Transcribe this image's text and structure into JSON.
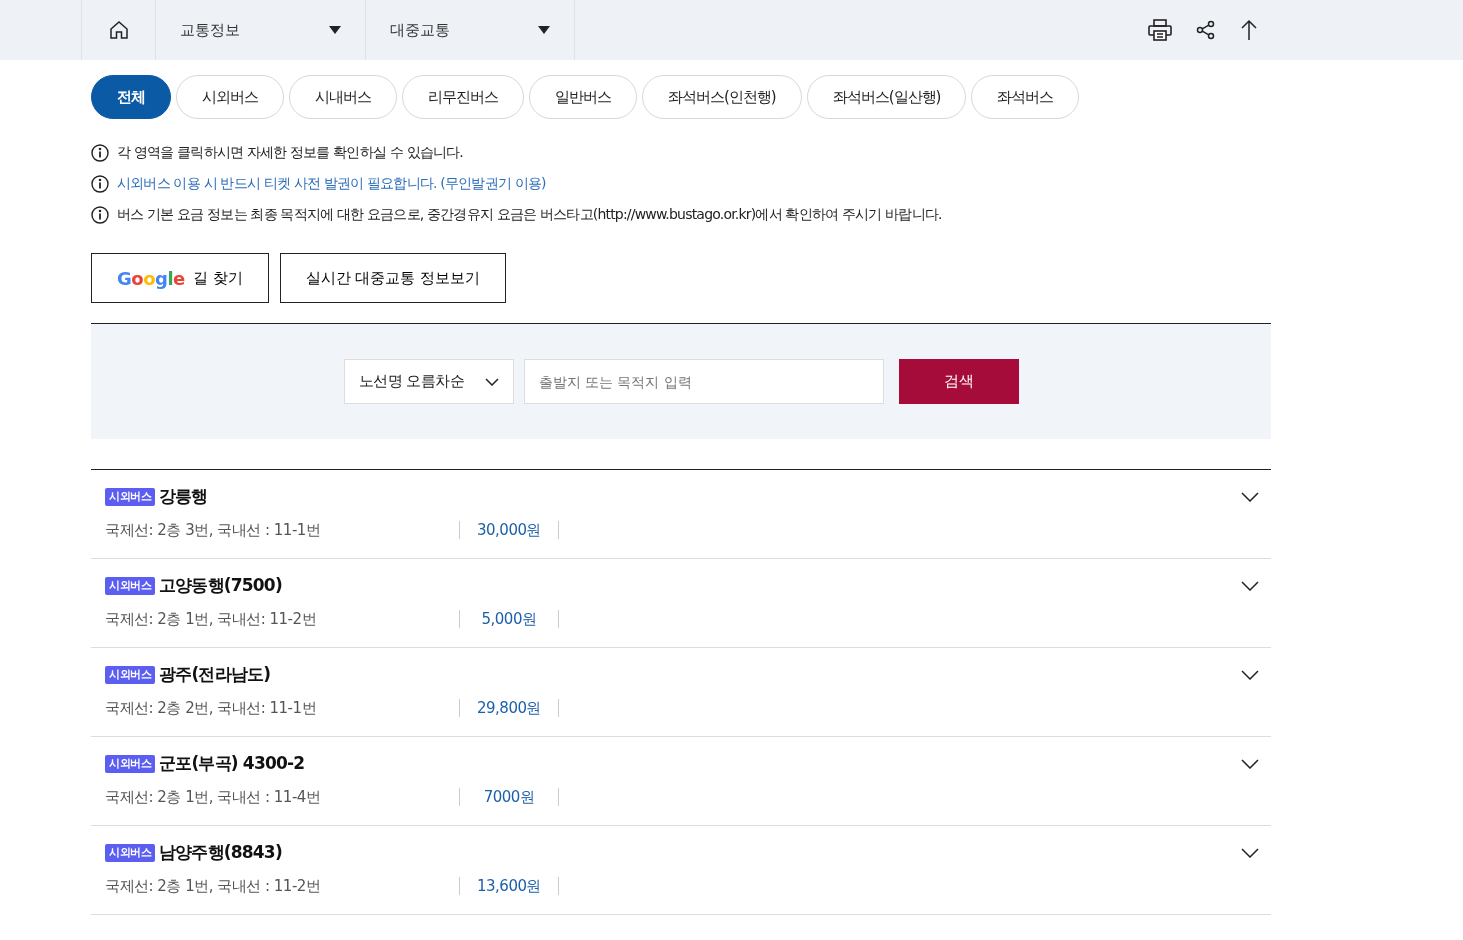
{
  "header": {
    "menus": [
      {
        "label": "교통정보"
      },
      {
        "label": "대중교통"
      }
    ]
  },
  "tabs": [
    {
      "label": "전체",
      "selected": true
    },
    {
      "label": "시외버스",
      "selected": false
    },
    {
      "label": "시내버스",
      "selected": false
    },
    {
      "label": "리무진버스",
      "selected": false
    },
    {
      "label": "일반버스",
      "selected": false
    },
    {
      "label": "좌석버스(인천행)",
      "selected": false
    },
    {
      "label": "좌석버스(일산행)",
      "selected": false
    },
    {
      "label": "좌석버스",
      "selected": false
    }
  ],
  "notices": [
    {
      "text": "각 영역을 클릭하시면 자세한 정보를 확인하실 수 있습니다.",
      "highlighted": false
    },
    {
      "text": "시외버스 이용 시 반드시 티켓 사전 발권이 필요합니다. (무인발권기 이용)",
      "highlighted": true
    },
    {
      "text": "버스 기본 요금 정보는 최종 목적지에 대한 요금으로, 중간경유지 요금은 버스타고(http://www.bustago.or.kr)에서 확인하여 주시기 바랍니다.",
      "highlighted": false
    }
  ],
  "buttons": {
    "google_logo": "Google",
    "google_label": "길 찾기",
    "realtime": "실시간 대중교통 정보보기"
  },
  "search": {
    "sort": "노선명 오름차순",
    "placeholder": "출발지 또는 목적지 입력",
    "button": "검색"
  },
  "routes": [
    {
      "badge": "시외버스",
      "title": "강릉행",
      "location": "국제선: 2층 3번, 국내선 : 11-1번",
      "fare": "30,000원",
      "expanded": false
    },
    {
      "badge": "시외버스",
      "title": "고양동행(7500)",
      "location": "국제선: 2층 1번, 국내선: 11-2번",
      "fare": "5,000원",
      "expanded": false
    },
    {
      "badge": "시외버스",
      "title": "광주(전라남도)",
      "location": "국제선: 2층 2번, 국내선: 11-1번",
      "fare": "29,800원",
      "expanded": false
    },
    {
      "badge": "시외버스",
      "title": "군포(부곡) 4300-2",
      "location": "국제선: 2층 1번, 국내선 : 11-4번",
      "fare": "7000원",
      "expanded": false
    },
    {
      "badge": "시외버스",
      "title": "남양주행(8843)",
      "location": "국제선: 2층 1번, 국내선 : 11-2번",
      "fare": "13,600원",
      "expanded": false
    }
  ]
}
